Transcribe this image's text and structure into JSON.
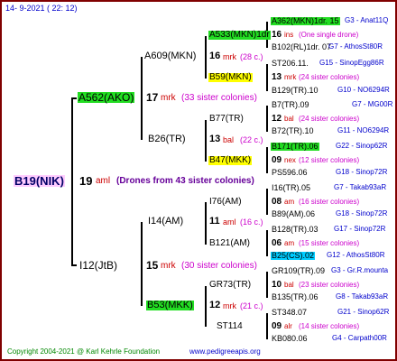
{
  "date": "14-  9-2021 (  22: 12)",
  "footer": {
    "copyright": "Copyright 2004-2021 @ Karl Kehrle Foundation",
    "site": "www.pedigreeapis.org"
  },
  "root": {
    "name": "B19(NIK)",
    "num": "19",
    "code": "aml",
    "note": "(Drones from 43 sister colonies)"
  },
  "gen1": [
    {
      "name": "A562(AKO)",
      "num": "17",
      "code": "mrk",
      "note": "(33 sister colonies)"
    },
    {
      "name": "I12(JtB)",
      "num": "15",
      "code": "mrk",
      "note": "(30 sister colonies)"
    }
  ],
  "gen2": [
    {
      "name": "A609(MKN)",
      "num": "16",
      "code": "mrk",
      "note": "(28 c.)"
    },
    {
      "name": "B26(TR)",
      "num": "13",
      "code": "bal",
      "note": "(22 c.)"
    },
    {
      "name": "I14(AM)",
      "num": "11",
      "code": "aml",
      "note": "(16 c.)"
    },
    {
      "name": "B53(MKK)",
      "num": "12",
      "code": "mrk",
      "note": "(21 c.)"
    }
  ],
  "gen3": [
    {
      "name": "A533(MKN)1dr",
      "num": "16",
      "code": "ins",
      "note": "(One single drone)"
    },
    {
      "name": "B59(MKN)",
      "num": "13",
      "code": "mrk",
      "note": "(24 sister colonies)"
    },
    {
      "name": "B77(TR)",
      "num": "12",
      "code": "bal",
      "note": "(24 sister colonies)"
    },
    {
      "name": "B47(MKK)",
      "num": "09",
      "code": "nex",
      "note": "(12 sister colonies)"
    },
    {
      "name": "I76(AM)",
      "num": "08",
      "code": "am",
      "note": "(16 sister colonies)"
    },
    {
      "name": "B121(AM)",
      "num": "06",
      "code": "am",
      "note": "(15 sister colonies)"
    },
    {
      "name": "GR73(TR)",
      "num": "10",
      "code": "bal",
      "note": "(23 sister colonies)"
    },
    {
      "name": "ST114",
      "num": "09",
      "code": "alr",
      "note": "(14 sister colonies)"
    }
  ],
  "gen4": [
    {
      "name": "A362(MKN)1dr. 15",
      "id": "G3 - Anat11Q"
    },
    {
      "name": "B102(RL)1dr. 07",
      "id": "G7 - AthosSt80R"
    },
    {
      "name": "ST206.11.",
      "id": "G15 - SinopEgg86R"
    },
    {
      "name": "B129(TR).10",
      "id": "G10 - NO6294R"
    },
    {
      "name": "B7(TR).09",
      "id": "G7 - MG00R"
    },
    {
      "name": "B72(TR).10",
      "id": "G11 - NO6294R"
    },
    {
      "name": "B171(TR).06",
      "id": "G22 - Sinop62R"
    },
    {
      "name": "PS596.06",
      "id": "G18 - Sinop72R"
    },
    {
      "name": "I16(TR).05",
      "id": "G7 - Takab93aR"
    },
    {
      "name": "B89(AM).06",
      "id": "G18 - Sinop72R"
    },
    {
      "name": "B128(TR).03",
      "id": "G17 - Sinop72R"
    },
    {
      "name": "B25(CS).02",
      "id": "G12 - AthosSt80R"
    },
    {
      "name": "GR109(TR).09",
      "id": "G3 - Gr.R.mounta"
    },
    {
      "name": "B135(TR).06",
      "id": "G8 - Takab93aR"
    },
    {
      "name": "ST348.07",
      "id": "G21 - Sinop62R"
    },
    {
      "name": "KB080.06",
      "id": "G4 - Carpath00R"
    }
  ]
}
